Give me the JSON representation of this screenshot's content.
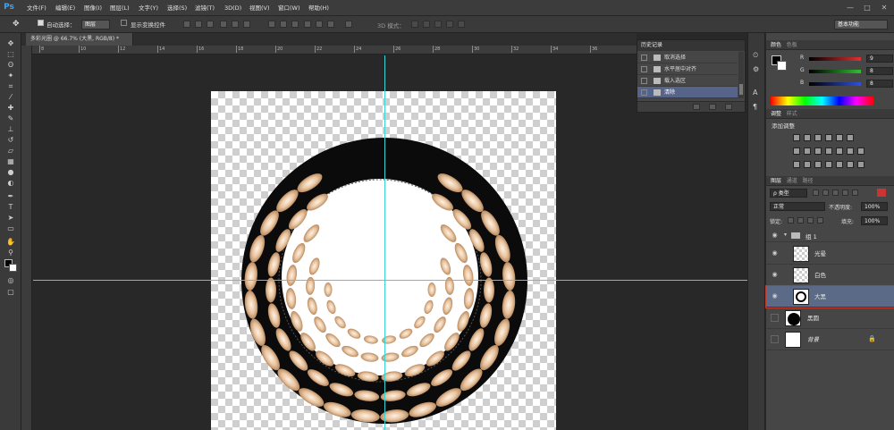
{
  "app": {
    "logo": "Ps",
    "accent": "#31a8ff"
  },
  "menu": [
    "文件(F)",
    "编辑(E)",
    "图像(I)",
    "图层(L)",
    "文字(Y)",
    "选择(S)",
    "滤镜(T)",
    "3D(D)",
    "视图(V)",
    "窗口(W)",
    "帮助(H)"
  ],
  "window_controls": [
    "—",
    "□",
    "✕"
  ],
  "options": {
    "auto_select_label": "自动选择：",
    "auto_select_value": "图层",
    "show_transform_label": "显示变换控件",
    "mode_3d_label": "3D 模式：",
    "workspace": "基本功能"
  },
  "document": {
    "tab_title": "多彩光圈 @ 66.7% (大黑, RGB/8) *",
    "ruler_ticks": [
      "8",
      "10",
      "12",
      "14",
      "16",
      "18",
      "20",
      "22",
      "24",
      "26",
      "28",
      "30",
      "32",
      "34",
      "36"
    ],
    "canvas_colors": {
      "ring": "#0b0b0b",
      "center": "#ffffff",
      "petal": "#e8c4a0",
      "guide": "#38d6d6"
    }
  },
  "history": {
    "title": "历史记录",
    "items": [
      {
        "label": "取消选择",
        "selected": false
      },
      {
        "label": "水平居中对齐",
        "selected": false
      },
      {
        "label": "载入选区",
        "selected": false
      },
      {
        "label": "清除",
        "selected": true
      }
    ]
  },
  "color_panel": {
    "tabs": [
      "颜色",
      "色板"
    ],
    "rows": [
      {
        "label": "R",
        "value": "9",
        "color": "#e03030"
      },
      {
        "label": "G",
        "value": "8",
        "color": "#30c030"
      },
      {
        "label": "B",
        "value": "8",
        "color": "#3050e0"
      }
    ]
  },
  "adjustments_panel": {
    "tabs": [
      "调整",
      "样式"
    ],
    "title": "添加调整"
  },
  "layers_panel": {
    "tabs": [
      "图层",
      "通道",
      "路径"
    ],
    "filter_label": "ρ 类型",
    "blend_mode": "正常",
    "opacity_label": "不透明度:",
    "opacity_value": "100%",
    "lock_label": "锁定:",
    "fill_label": "填充:",
    "fill_value": "100%",
    "group_name": "组 1",
    "layers": [
      {
        "name": "光晕",
        "thumb": "checker",
        "selected": false,
        "visible": true
      },
      {
        "name": "白色",
        "thumb": "checker",
        "selected": false,
        "visible": true
      },
      {
        "name": "大黑",
        "thumb": "ring",
        "selected": true,
        "visible": true
      },
      {
        "name": "黑圆",
        "thumb": "disc",
        "selected": false,
        "visible": false
      },
      {
        "name": "背景",
        "thumb": "white",
        "selected": false,
        "visible": false
      }
    ]
  },
  "icons": [
    "move-tool-icon",
    "marquee-icon",
    "lasso-icon",
    "magic-wand-icon",
    "crop-icon",
    "eyedropper-icon",
    "healing-icon",
    "brush-icon",
    "stamp-icon",
    "history-brush-icon",
    "eraser-icon",
    "gradient-icon",
    "blur-icon",
    "dodge-icon",
    "pen-icon",
    "type-icon",
    "path-select-icon",
    "shape-icon",
    "hand-icon",
    "zoom-icon",
    "eye-icon",
    "lock-icon",
    "folder-icon"
  ]
}
